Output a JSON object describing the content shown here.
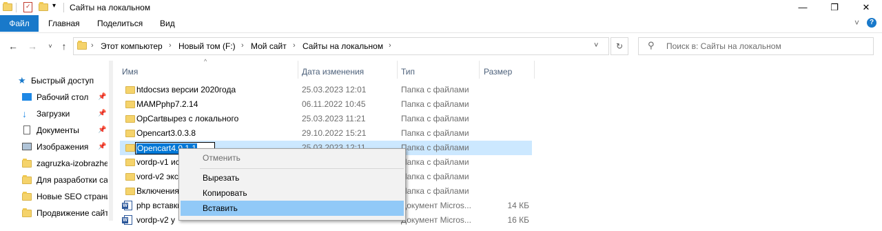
{
  "window": {
    "title": "Сайты на локальном",
    "controls": [
      "—",
      "❐",
      "✕"
    ]
  },
  "ribbon": {
    "file": "Файл",
    "tabs": [
      "Главная",
      "Поделиться",
      "Вид"
    ],
    "expand": "˅",
    "help": "?"
  },
  "address": {
    "crumbs": [
      "Этот компьютер",
      "Новый том (F:)",
      "Мой сайт",
      "Сайты на локальном"
    ],
    "search_placeholder": "Поиск в: Сайты на локальном"
  },
  "nav": {
    "items": [
      {
        "label": "Быстрый доступ",
        "icon": "star-icon"
      },
      {
        "label": "Рабочий стол",
        "icon": "desktop-icon",
        "pinned": true
      },
      {
        "label": "Загрузки",
        "icon": "download-icon",
        "pinned": true
      },
      {
        "label": "Документы",
        "icon": "documents-icon",
        "pinned": true
      },
      {
        "label": "Изображения",
        "icon": "pictures-icon",
        "pinned": true
      },
      {
        "label": "zagruzka-izobrazhen",
        "icon": "folder-icon"
      },
      {
        "label": "Для разработки са",
        "icon": "folder-icon"
      },
      {
        "label": "Новые SEO страни",
        "icon": "folder-icon"
      },
      {
        "label": "Продвижение сайт",
        "icon": "folder-icon"
      }
    ]
  },
  "columns": {
    "name": "Имя",
    "date": "Дата изменения",
    "type": "Тип",
    "size": "Размер"
  },
  "files": [
    {
      "name": "htdocsиз версии 2020года",
      "date": "25.03.2023 12:01",
      "type": "Папка с файлами",
      "size": ""
    },
    {
      "name": "MAMPphp7.2.14",
      "date": "06.11.2022 10:45",
      "type": "Папка с файлами",
      "size": ""
    },
    {
      "name": "OpCartвырез с локального",
      "date": "25.03.2023 11:21",
      "type": "Папка с файлами",
      "size": ""
    },
    {
      "name": "Opencart3.0.3.8",
      "date": "29.10.2022 15:21",
      "type": "Папка с файлами",
      "size": ""
    },
    {
      "name": "Opencart4.0.1.1",
      "date": "25.03.2023 12:11",
      "type": "Папка с файлами",
      "size": ""
    },
    {
      "name": "vordp-v1 ис",
      "date": "",
      "type": "Папка с файлами",
      "size": ""
    },
    {
      "name": "vord-v2 экс",
      "date": "",
      "type": "Папка с файлами",
      "size": ""
    },
    {
      "name": "Включения",
      "date": "",
      "type": "Папка с файлами",
      "size": ""
    },
    {
      "name": "php вставки",
      "date": "",
      "type": "Документ Micros...",
      "size": "14 КБ"
    },
    {
      "name": "vordp-v2 у",
      "date": "",
      "type": "Документ Micros...",
      "size": "16 КБ"
    }
  ],
  "rename_value": "Opencart4.0.1.1",
  "context_menu": {
    "items": [
      "Отменить",
      "Вырезать",
      "Копировать",
      "Вставить"
    ]
  }
}
